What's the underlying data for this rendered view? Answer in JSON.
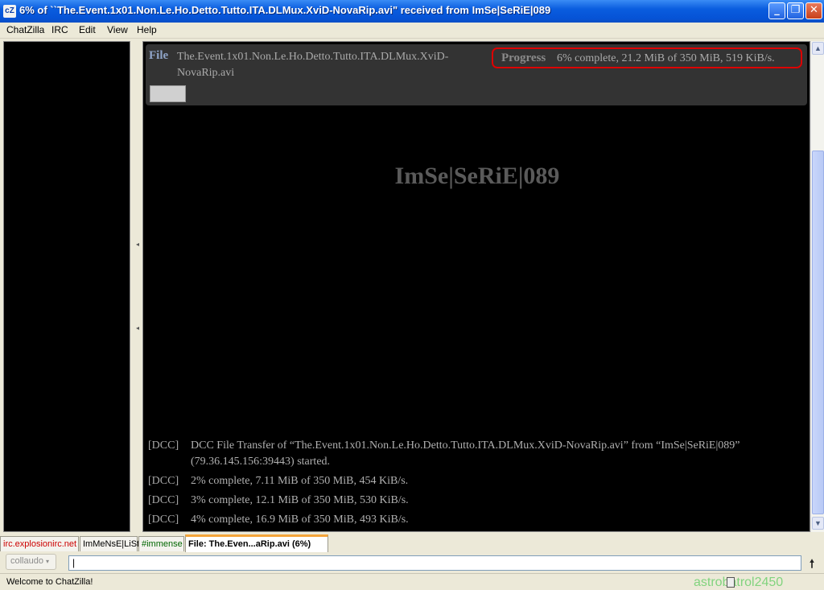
{
  "window": {
    "title": "6% of ``The.Event.1x01.Non.Le.Ho.Detto.Tutto.ITA.DLMux.XviD-NovaRip.avi\" received from ImSe|SeRiE|089",
    "app_icon": "cZ",
    "minimize_glyph": "_",
    "maximize_glyph": "❐",
    "close_glyph": "✕"
  },
  "menu": {
    "items": [
      "ChatZilla",
      "IRC",
      "Edit",
      "View",
      "Help"
    ]
  },
  "transfer": {
    "file_label": "File",
    "file_name": "The.Event.1x01.Non.Le.Ho.Detto.Tutto.ITA.DLMux.XviD-NovaRip.avi",
    "progress_label": "Progress",
    "progress_text": "6% complete, 21.2 MiB of 350 MiB, 519 KiB/s.",
    "progress_fraction": 0.06,
    "sender": "ImSe|SeRiE|089"
  },
  "log": [
    {
      "tag": "[DCC]",
      "msg": "DCC File Transfer of “The.Event.1x01.Non.Le.Ho.Detto.Tutto.ITA.DLMux.XviD-NovaRip.avi” from “ImSe|SeRiE|089” (79.36.145.156:39443) started."
    },
    {
      "tag": "[DCC]",
      "msg": "2% complete, 7.11 MiB of 350 MiB, 454 KiB/s."
    },
    {
      "tag": "[DCC]",
      "msg": "3% complete, 12.1 MiB of 350 MiB, 530 KiB/s."
    },
    {
      "tag": "[DCC]",
      "msg": "4% complete, 16.9 MiB of 350 MiB, 493 KiB/s."
    }
  ],
  "tabs": [
    {
      "label": "irc.explosionirc.net",
      "color": "#cc0000"
    },
    {
      "label": "ImMeNsE|LiSt",
      "color": "#000000"
    },
    {
      "label": "#immense",
      "color": "#006600"
    },
    {
      "label": "File: The.Even...aRip.avi (6%)",
      "color": "#000000",
      "active": true
    }
  ],
  "input": {
    "nick": "collaudo",
    "value": "|"
  },
  "status": {
    "text": "Welcome to ChatZilla!",
    "corner_text": "astrobatrol2450"
  },
  "colors": {
    "titlebar": "#0a5ddf",
    "highlight_border": "#dd0000",
    "active_tab_accent": "#f5a53a"
  }
}
